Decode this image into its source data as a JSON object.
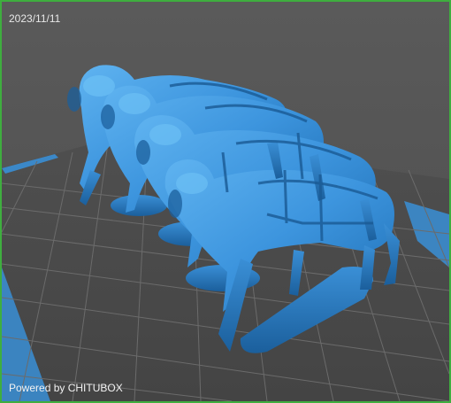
{
  "window": {
    "date_label": "2023/11/11",
    "powered_label": "Powered by CHITUBOX"
  },
  "viewport": {
    "model_icon": "horse-team-model",
    "colors": {
      "background": "#555555",
      "border": "#3fae3f",
      "build_plate": "#4a4a4a",
      "grid_line": "#6a6a6a",
      "plate_edge": "#3a8fd6",
      "model_light": "#3d9be6",
      "model_dark": "#1f6fb5"
    }
  }
}
